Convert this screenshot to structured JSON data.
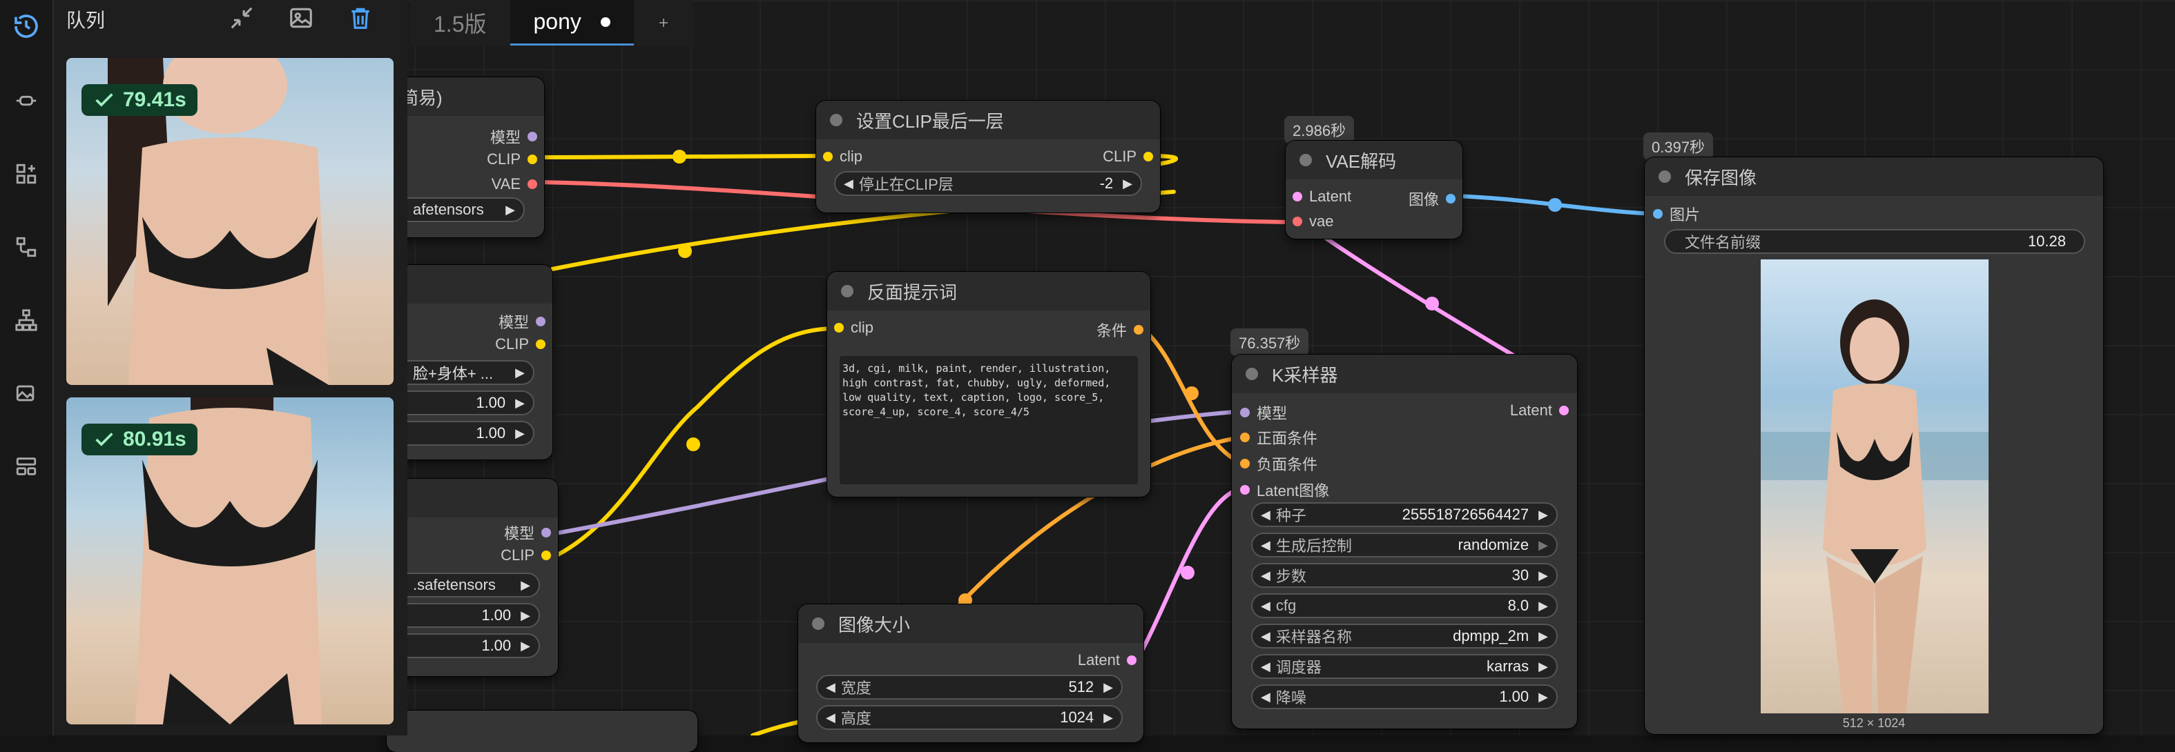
{
  "queue": {
    "title": "队列",
    "items": [
      {
        "time": "79.41s"
      },
      {
        "time": "80.91s"
      }
    ]
  },
  "tabs": [
    {
      "label": "1.5版"
    },
    {
      "label": "pony"
    }
  ],
  "nodes": {
    "checkpoint": {
      "title_partial": "简易)",
      "out_model": "模型",
      "out_clip": "CLIP",
      "out_vae": "VAE",
      "ckpt": "afetensors"
    },
    "lora1": {
      "out_model": "模型",
      "out_clip": "CLIP",
      "lora_name": "脸+身体+ ...",
      "strength_model": "1.00",
      "strength_clip": "1.00"
    },
    "lora2": {
      "out_model": "模型",
      "out_clip": "CLIP",
      "lora_name": ".safetensors",
      "strength_model": "1.00",
      "strength_clip": "1.00"
    },
    "clip_set_last": {
      "title": "设置CLIP最后一层",
      "in_clip": "clip",
      "out_clip": "CLIP",
      "widget_label": "停止在CLIP层",
      "widget_value": "-2"
    },
    "negative": {
      "title": "反面提示词",
      "in_clip": "clip",
      "out_cond": "条件",
      "text": "3d, cgi, milk, paint, render, illustration, high contrast, fat, chubby, ugly, deformed, low quality, text, caption, logo, score_5, score_4_up, score_4, score_4/5"
    },
    "vae_decode": {
      "badge": "2.986秒",
      "title": "VAE解码",
      "in_latent": "Latent",
      "in_vae": "vae",
      "out_image": "图像"
    },
    "ksampler": {
      "badge": "76.357秒",
      "title": "K采样器",
      "in_model": "模型",
      "in_pos": "正面条件",
      "in_neg": "负面条件",
      "in_latent": "Latent图像",
      "out_latent": "Latent",
      "widgets": [
        {
          "label": "种子",
          "value": "255518726564427"
        },
        {
          "label": "生成后控制",
          "value": "randomize"
        },
        {
          "label": "步数",
          "value": "30"
        },
        {
          "label": "cfg",
          "value": "8.0"
        },
        {
          "label": "采样器名称",
          "value": "dpmpp_2m"
        },
        {
          "label": "调度器",
          "value": "karras"
        },
        {
          "label": "降噪",
          "value": "1.00"
        }
      ]
    },
    "empty_latent": {
      "title": "图像大小",
      "out_latent": "Latent",
      "width_label": "宽度",
      "width_value": "512",
      "height_label": "高度",
      "height_value": "1024"
    },
    "save_image": {
      "badge": "0.397秒",
      "title": "保存图像",
      "in_images": "图片",
      "prefix_label": "文件名前缀",
      "prefix_value": "10.28",
      "dims": "512 × 1024"
    }
  },
  "colors": {
    "clip": "#ffd500",
    "model": "#b39ddb",
    "vae": "#ff6e6e",
    "latent": "#ff9cf9",
    "cond": "#ffa931",
    "image": "#64b5f6"
  }
}
